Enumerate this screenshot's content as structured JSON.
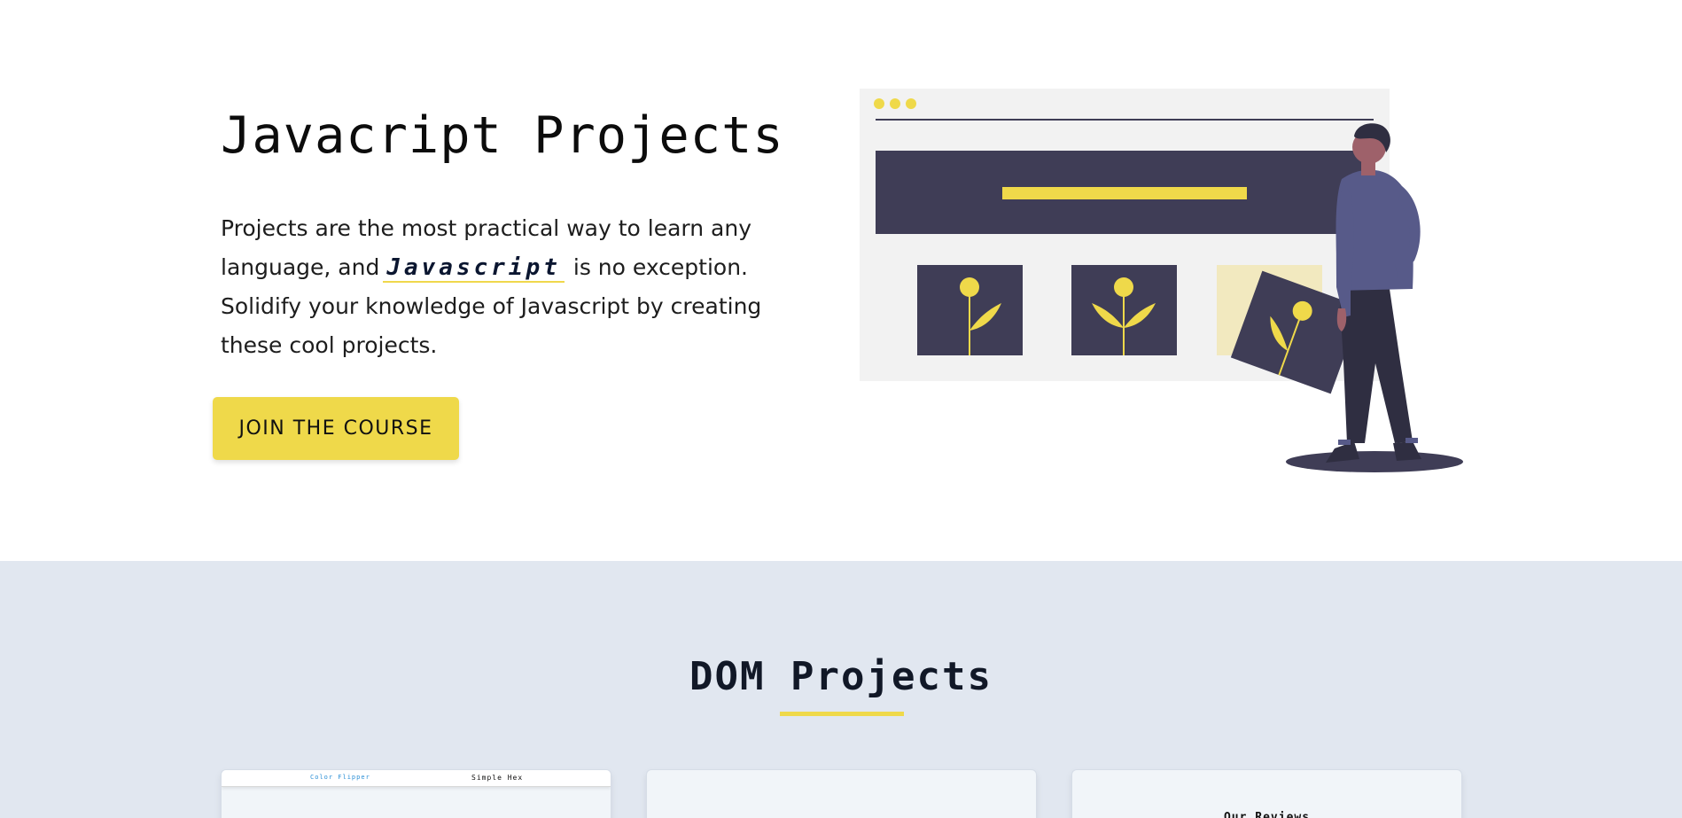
{
  "hero": {
    "title": "Javacript Projects",
    "description_before": "Projects are the most practical way to learn any language, and",
    "description_highlight": "Javascript",
    "description_after": "is no exception. Solidify your knowledge of Javascript by creating these cool projects.",
    "cta_label": "JOIN THE COURSE"
  },
  "colors": {
    "accent": "#efd94a",
    "dark": "#3f3d56",
    "section_bg": "#e1e7f0"
  },
  "projects": {
    "title": "DOM Projects",
    "cards": [
      {
        "nav_left": "Color Flipper",
        "nav_right": "Simple Hex"
      },
      {},
      {
        "heading": "Our Reviews"
      }
    ]
  }
}
